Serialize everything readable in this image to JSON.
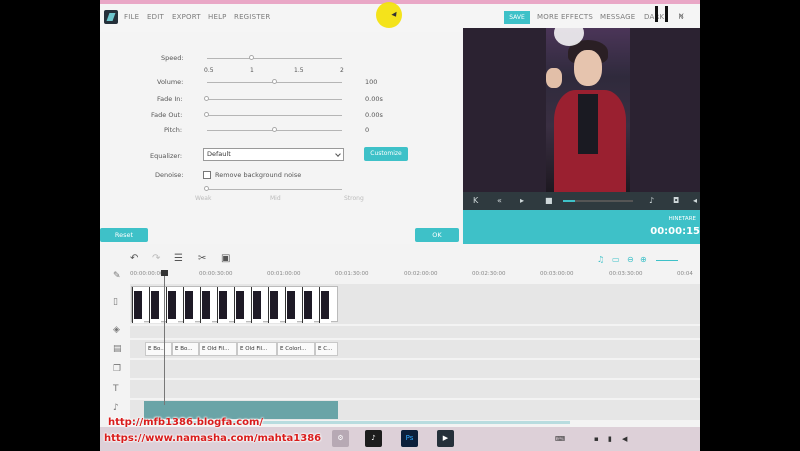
{
  "menu": {
    "items": [
      "FILE",
      "EDIT",
      "EXPORT",
      "HELP",
      "REGISTER"
    ],
    "save": "SAVE",
    "more_effects": "MORE EFFECTS",
    "message": "MESSAGE",
    "dark": "DARK",
    "dark_suffix": "N"
  },
  "audio_panel": {
    "speed_label": "Speed:",
    "speed_ticks": [
      "0.5",
      "1",
      "1.5",
      "2"
    ],
    "speed_value": 1,
    "volume_label": "Volume:",
    "volume_value": "100",
    "fadein_label": "Fade In:",
    "fadein_value": "0.00s",
    "fadeout_label": "Fade Out:",
    "fadeout_value": "0.00s",
    "pitch_label": "Pitch:",
    "pitch_value": "0",
    "equalizer_label": "Equalizer:",
    "equalizer_value": "Default",
    "customize_label": "Customize",
    "denoise_label": "Denoise:",
    "remove_noise_label": "Remove background noise",
    "denoise_levels": [
      "Weak",
      "Mid",
      "Strong"
    ],
    "reset_label": "Reset",
    "ok_label": "OK"
  },
  "preview": {
    "time_label": "00:00:15",
    "time_caption": "HINETARE"
  },
  "timeline": {
    "ruler": [
      "00:00:00:00",
      "00:00:30:00",
      "00:01:00:00",
      "00:01:30:00",
      "00:02:00:00",
      "00:02:30:00",
      "00:03:00:00",
      "00:03:30:00",
      "00:04"
    ],
    "effects": [
      "E Bo...",
      "E Bo...",
      "E Old Fil...",
      "E Old Fil...",
      "E Colorl...",
      "E C..."
    ]
  },
  "watermark": {
    "line1": "http://mfb1386.blogfa.com/",
    "line2": "https://www.namasha.com/mahta1386"
  },
  "taskbar": {
    "ps_label": "Ps"
  },
  "colors": {
    "accent": "#3ec1c8",
    "watermark": "#d91c1c"
  }
}
